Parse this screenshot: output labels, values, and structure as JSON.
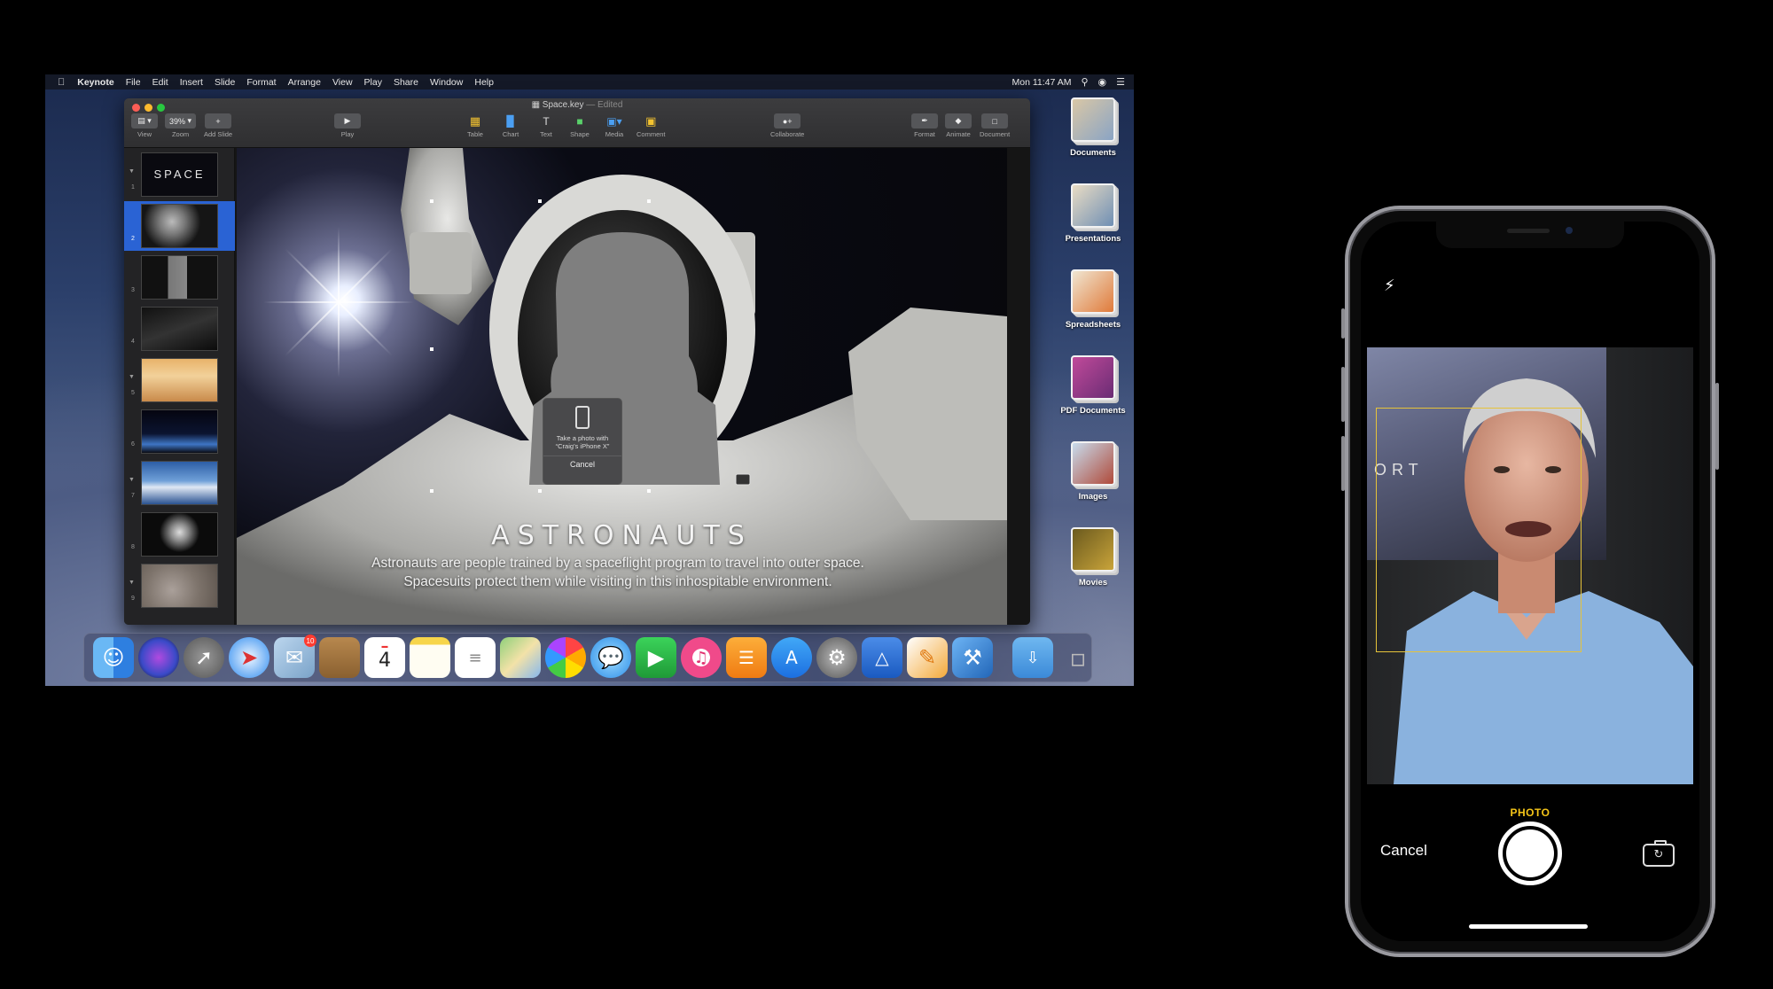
{
  "menubar": {
    "app_name": "Keynote",
    "items": [
      "File",
      "Edit",
      "Insert",
      "Slide",
      "Format",
      "Arrange",
      "View",
      "Play",
      "Share",
      "Window",
      "Help"
    ],
    "clock": "Mon 11:47 AM"
  },
  "window": {
    "document_name": "Space.key",
    "document_state": "— Edited"
  },
  "toolbar": {
    "view": {
      "label": "View",
      "icon": "sidebar-icon"
    },
    "zoom": {
      "label": "Zoom",
      "value": "39%"
    },
    "add_slide": {
      "label": "Add Slide",
      "icon": "plus-icon"
    },
    "play": {
      "label": "Play",
      "icon": "play-icon"
    },
    "table": {
      "label": "Table",
      "icon": "table-icon"
    },
    "chart": {
      "label": "Chart",
      "icon": "chart-icon"
    },
    "text": {
      "label": "Text",
      "icon": "text-icon"
    },
    "shape": {
      "label": "Shape",
      "icon": "shape-icon"
    },
    "media": {
      "label": "Media",
      "icon": "media-icon"
    },
    "comment": {
      "label": "Comment",
      "icon": "comment-icon"
    },
    "collaborate": {
      "label": "Collaborate",
      "icon": "collaborate-icon"
    },
    "format": {
      "label": "Format",
      "icon": "paintbrush-icon"
    },
    "animate": {
      "label": "Animate",
      "icon": "animate-icon"
    },
    "document": {
      "label": "Document",
      "icon": "document-icon"
    }
  },
  "navigator": {
    "slides": [
      {
        "num": "1",
        "title": "SPACE"
      },
      {
        "num": "2",
        "selected": true
      },
      {
        "num": "3"
      },
      {
        "num": "4"
      },
      {
        "num": "5"
      },
      {
        "num": "6"
      },
      {
        "num": "7"
      },
      {
        "num": "8"
      },
      {
        "num": "9"
      }
    ]
  },
  "slide": {
    "title": "ASTRONAUTS",
    "body_line1": "Astronauts are people trained by a spaceflight program to travel into outer space.",
    "body_line2": "Spacesuits protect them while visiting in this inhospitable environment."
  },
  "camera_popover": {
    "message_line1": "Take a photo with",
    "message_line2": "“Craig’s iPhone X”",
    "cancel": "Cancel"
  },
  "desktop_stacks": [
    "Documents",
    "Presentations",
    "Spreadsheets",
    "PDF Documents",
    "Images",
    "Movies"
  ],
  "dock": {
    "apps": [
      "finder-icon",
      "siri-icon",
      "launchpad-icon",
      "safari-icon",
      "mail-icon",
      "contacts-icon",
      "calendar-icon",
      "notes-icon",
      "reminders-icon",
      "maps-icon",
      "photos-icon",
      "messages-icon",
      "facetime-icon",
      "itunes-icon",
      "ibooks-icon",
      "app-store-icon",
      "system-preferences-icon",
      "keynote-icon",
      "pages-icon",
      "xcode-icon"
    ],
    "calendar_day": "4",
    "mail_badge": "10"
  },
  "iphone": {
    "mode": "PHOTO",
    "cancel": "Cancel",
    "viewfinder_text": "ORT"
  },
  "colors": {
    "selection": "#2a63d4",
    "camera_mode": "#f5c518",
    "close": "#fc5d55",
    "minimize": "#fdbb2e",
    "maximize": "#28c840"
  }
}
